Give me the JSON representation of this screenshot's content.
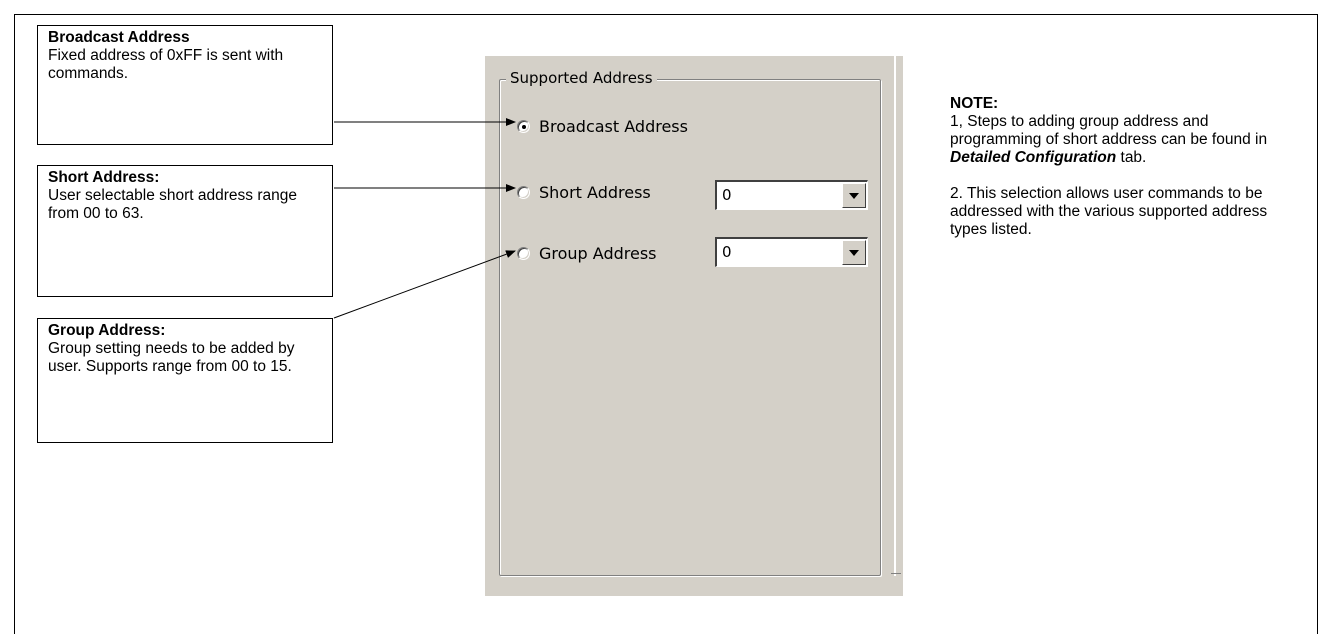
{
  "callouts": {
    "broadcast": {
      "title": "Broadcast Address",
      "desc": "Fixed address of 0xFF is sent with commands."
    },
    "short": {
      "title": "Short Address:",
      "desc": "User selectable short address range from 00 to 63."
    },
    "group": {
      "title": "Group Address:",
      "desc": "Group setting needs to be added by user. Supports range from 00 to 15."
    }
  },
  "panel": {
    "groupbox_title": "Supported Address",
    "options": {
      "broadcast": {
        "label": "Broadcast Address",
        "selected": true
      },
      "short": {
        "label": "Short Address",
        "value": "0"
      },
      "group": {
        "label": "Group Address",
        "value": "0"
      }
    }
  },
  "note": {
    "title": "NOTE:",
    "line1_pre": "1, Steps to adding group address and programming of short address can be found in ",
    "line1_bold": "Detailed Configuration",
    "line1_post": " tab.",
    "line2": "2. This selection allows user commands to be addressed with the various supported address types listed."
  },
  "colors": {
    "panel_bg": "#d4d0c8",
    "frame": "#000000"
  }
}
